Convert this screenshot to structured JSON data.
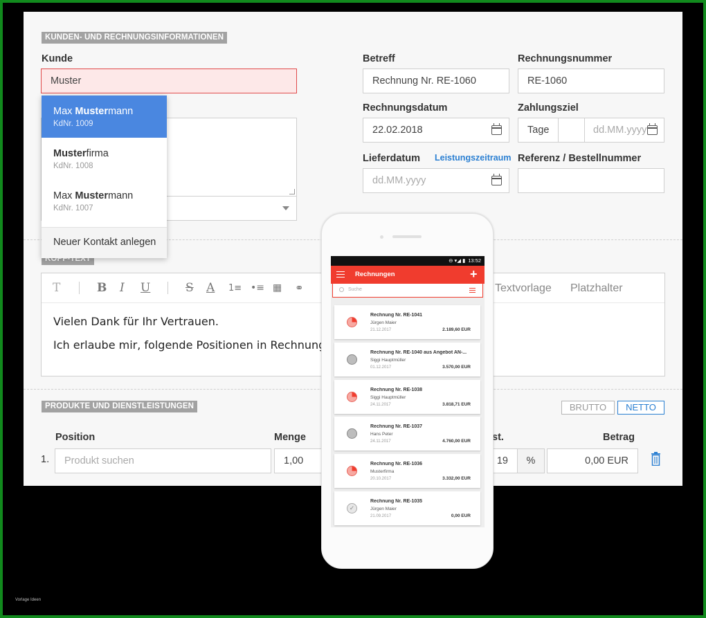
{
  "sections": {
    "customer_info": "KUNDEN- UND RECHNUNGSINFORMATIONEN",
    "header_text": "KOPF-TEXT",
    "products": "PRODUKTE UND DIENSTLEISTUNGEN"
  },
  "customer": {
    "label": "Kunde",
    "value": "Muster",
    "suggestions": [
      {
        "prefix": "Max ",
        "match": "Muster",
        "suffix": "mann",
        "sub": "KdNr. 1009"
      },
      {
        "prefix": "",
        "match": "Muster",
        "suffix": "firma",
        "sub": "KdNr. 1008"
      },
      {
        "prefix": "Max ",
        "match": "Muster",
        "suffix": "mann",
        "sub": "KdNr. 1007"
      }
    ],
    "new_contact": "Neuer Kontakt anlegen"
  },
  "fields": {
    "subject_label": "Betreff",
    "subject_value": "Rechnung Nr. RE-1060",
    "invoice_no_label": "Rechnungsnummer",
    "invoice_no_value": "RE-1060",
    "invoice_date_label": "Rechnungsdatum",
    "invoice_date_value": "22.02.2018",
    "payment_term_label": "Zahlungsziel",
    "payment_term_unit": "Tage",
    "payment_term_date_placeholder": "dd.MM.yyyy",
    "delivery_date_label": "Lieferdatum",
    "service_period_link": "Leistungszeitraum",
    "delivery_date_placeholder": "dd.MM.yyyy",
    "reference_label": "Referenz / Bestellnummer"
  },
  "editor": {
    "toolbar_text_templates": "Textvorlage",
    "toolbar_placeholders": "Platzhalter",
    "line1": "Vielen Dank für Ihr Vertrauen.",
    "line2": "Ich erlaube mir, folgende Positionen in Rechnungen zu stellen:"
  },
  "products": {
    "toggle_gross": "BRUTTO",
    "toggle_net": "NETTO",
    "col_position": "Position",
    "col_quantity": "Menge",
    "col_vat": "st.",
    "col_amount": "Betrag",
    "row_number": "1.",
    "product_placeholder": "Produkt suchen",
    "quantity_value": "1,00",
    "vat_value": "19",
    "vat_unit": "%",
    "amount_value": "0,00 EUR"
  },
  "phone": {
    "status_time": "13:52",
    "app_title": "Rechnungen",
    "search_placeholder": "Suche",
    "invoices": [
      {
        "title": "Rechnung Nr. RE-1041",
        "name": "Jürgen Maier",
        "date": "21.12.2017",
        "amount": "2.189,60 EUR",
        "status": "pie"
      },
      {
        "title": "Rechnung Nr. RE-1040 aus Angebot AN-...",
        "name": "Siggi Hauptmüller",
        "date": "01.12.2017",
        "amount": "3.570,00 EUR",
        "status": "gray"
      },
      {
        "title": "Rechnung Nr. RE-1038",
        "name": "Siggi Hauptmüller",
        "date": "24.11.2017",
        "amount": "3.818,71 EUR",
        "status": "pie"
      },
      {
        "title": "Rechnung Nr. RE-1037",
        "name": "Hans Peter",
        "date": "24.11.2017",
        "amount": "4.760,00 EUR",
        "status": "gray"
      },
      {
        "title": "Rechnung Nr. RE-1036",
        "name": "Musterfirma",
        "date": "20.10.2017",
        "amount": "3.332,00 EUR",
        "status": "pie"
      },
      {
        "title": "Rechnung Nr. RE-1035",
        "name": "Jürgen Maier",
        "date": "21.09.2017",
        "amount": "0,00 EUR",
        "status": "done"
      }
    ]
  },
  "watermark": "Vorlage Ideen",
  "colors": {
    "accent_red": "#f03c2e",
    "accent_blue": "#2a7fd2",
    "frame_green": "#118a1d"
  }
}
